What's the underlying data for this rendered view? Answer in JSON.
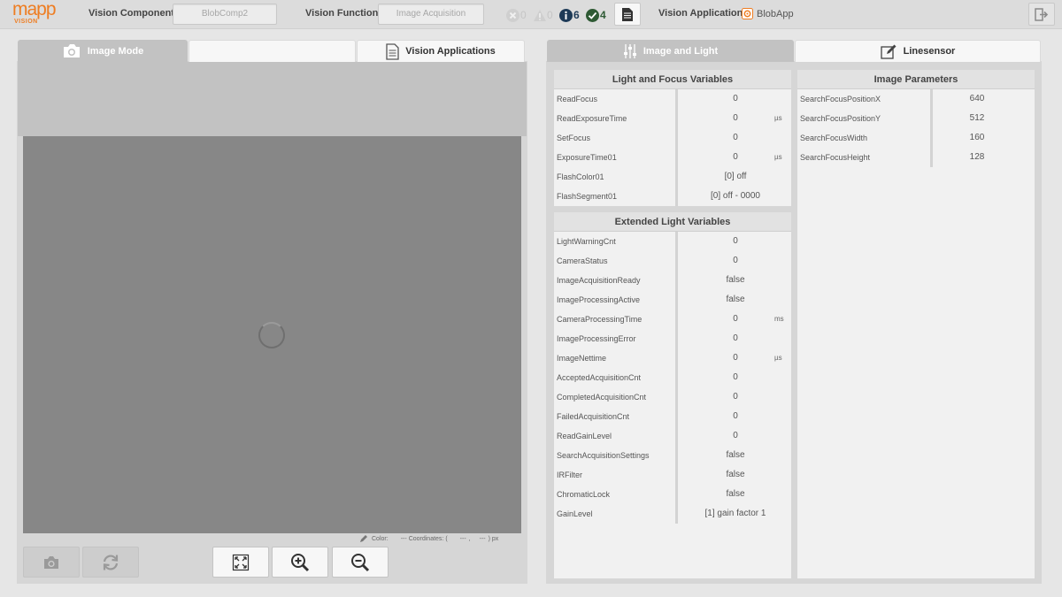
{
  "header": {
    "logo_main": "mapp",
    "logo_sub": "VISION",
    "vision_component_label": "Vision Component:",
    "vision_component_value": "BlobComp2",
    "vision_function_label": "Vision Function:",
    "vision_function_value": "Image Acquisition",
    "status": {
      "errors": "0",
      "warnings": "0",
      "info": "6",
      "ok": "4"
    },
    "vision_application_label": "Vision Application:",
    "vision_application_value": "BlobApp",
    "colors": {
      "accent": "#ee7d22",
      "info": "#1d3a57",
      "ok": "#2e5a34"
    }
  },
  "left_tabs": [
    {
      "label": "Image Mode",
      "icon": "camera-icon"
    },
    {
      "label": "",
      "icon": ""
    },
    {
      "label": "Vision Applications",
      "icon": "document-icon"
    }
  ],
  "image_view": {
    "color_label": "Color:",
    "color_value": "---",
    "coordinates_label": "Coordinates: (",
    "coord_x": "---",
    "coord_y": "---",
    "unit": ") px"
  },
  "right_tabs": [
    {
      "label": "Image and Light",
      "icon": "sliders-icon"
    },
    {
      "label": "Linesensor",
      "icon": "edit-icon"
    }
  ],
  "light_focus": {
    "title": "Light and Focus Variables",
    "rows": [
      {
        "name": "ReadFocus",
        "value": "0",
        "unit": ""
      },
      {
        "name": "ReadExposureTime",
        "value": "0",
        "unit": "µs"
      },
      {
        "name": "SetFocus",
        "value": "0",
        "unit": ""
      },
      {
        "name": "ExposureTime01",
        "value": "0",
        "unit": "µs"
      },
      {
        "name": "FlashColor01",
        "value": "[0] off",
        "unit": ""
      },
      {
        "name": "FlashSegment01",
        "value": "[0] off - 0000",
        "unit": ""
      }
    ]
  },
  "extended_light": {
    "title": "Extended Light Variables",
    "rows": [
      {
        "name": "LightWarningCnt",
        "value": "0",
        "unit": ""
      },
      {
        "name": "CameraStatus",
        "value": "0",
        "unit": ""
      },
      {
        "name": "ImageAcquisitionReady",
        "value": "false",
        "unit": ""
      },
      {
        "name": "ImageProcessingActive",
        "value": "false",
        "unit": ""
      },
      {
        "name": "CameraProcessingTime",
        "value": "0",
        "unit": "ms"
      },
      {
        "name": "ImageProcessingError",
        "value": "0",
        "unit": ""
      },
      {
        "name": "ImageNettime",
        "value": "0",
        "unit": "µs"
      },
      {
        "name": "AcceptedAcquisitionCnt",
        "value": "0",
        "unit": ""
      },
      {
        "name": "CompletedAcquisitionCnt",
        "value": "0",
        "unit": ""
      },
      {
        "name": "FailedAcquisitionCnt",
        "value": "0",
        "unit": ""
      },
      {
        "name": "ReadGainLevel",
        "value": "0",
        "unit": ""
      },
      {
        "name": "SearchAcquisitionSettings",
        "value": "false",
        "unit": ""
      },
      {
        "name": "IRFilter",
        "value": "false",
        "unit": ""
      },
      {
        "name": "ChromaticLock",
        "value": "false",
        "unit": ""
      },
      {
        "name": "GainLevel",
        "value": "[1] gain factor 1",
        "unit": ""
      }
    ]
  },
  "image_params": {
    "title": "Image Parameters",
    "rows": [
      {
        "name": "SearchFocusPositionX",
        "value": "640"
      },
      {
        "name": "SearchFocusPositionY",
        "value": "512"
      },
      {
        "name": "SearchFocusWidth",
        "value": "160"
      },
      {
        "name": "SearchFocusHeight",
        "value": "128"
      }
    ]
  }
}
